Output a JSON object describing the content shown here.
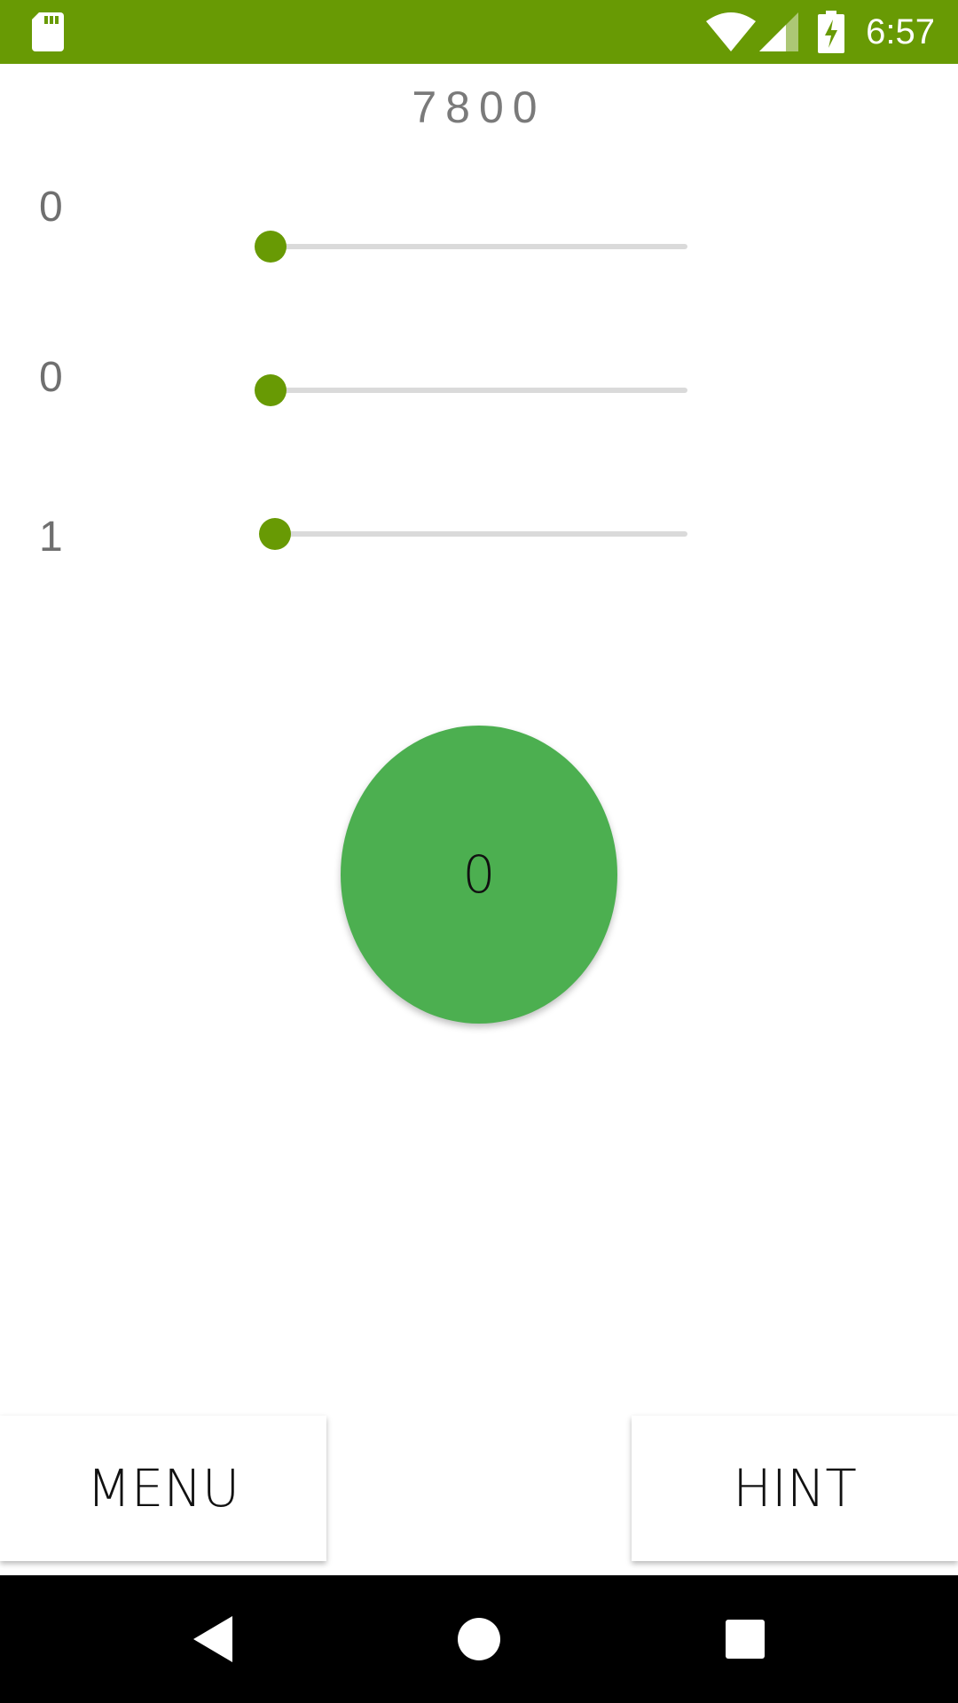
{
  "status_bar": {
    "time": "6:57",
    "background_color": "#689a04",
    "icons": [
      "sd-card-icon",
      "wifi-icon",
      "signal-icon",
      "battery-charging-icon"
    ]
  },
  "game": {
    "score": "7800",
    "accent_color": "#689a04",
    "sliders": [
      {
        "value_label": "0",
        "level": 0.0
      },
      {
        "value_label": "0",
        "level": 0.0
      },
      {
        "value_label": "1",
        "level": 0.01
      }
    ],
    "center_button": {
      "label": "0",
      "color": "#4caf50"
    }
  },
  "buttons": {
    "menu_label": "MENU",
    "hint_label": "HINT"
  },
  "nav_bar": {
    "icons": [
      "back-icon",
      "home-icon",
      "recents-icon"
    ]
  }
}
